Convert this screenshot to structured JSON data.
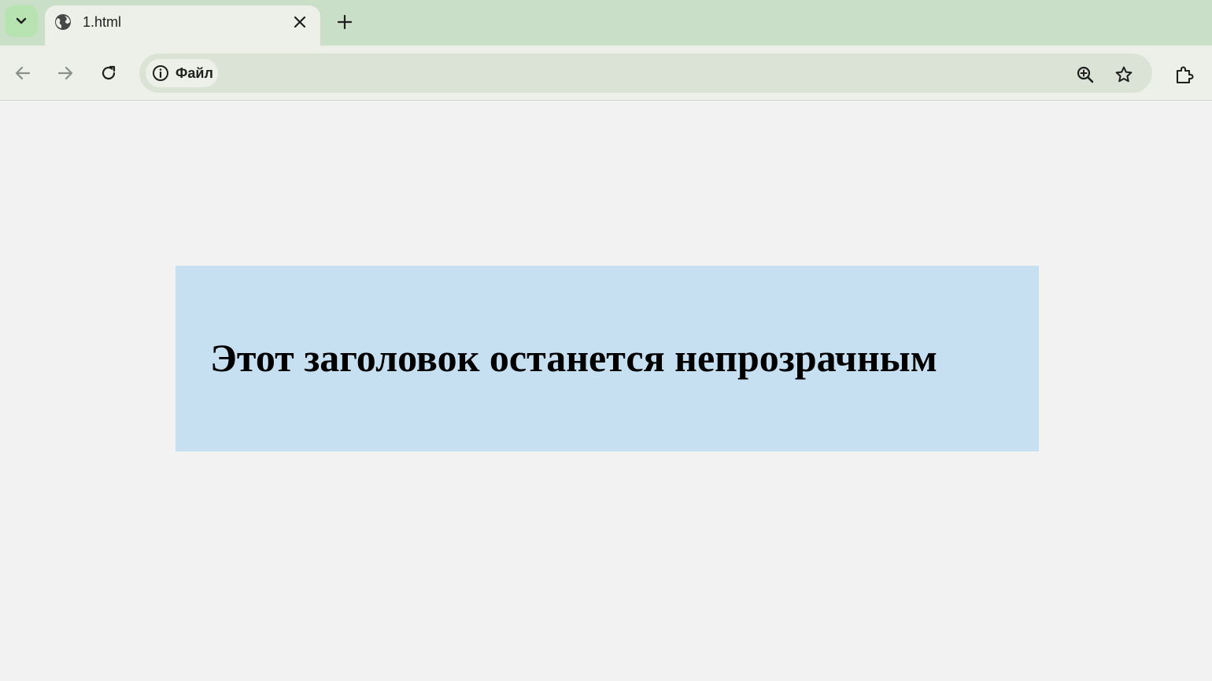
{
  "browser": {
    "tab": {
      "title": "1.html"
    },
    "address": {
      "chip_label": "Файл"
    },
    "icons": {
      "tab_search": "chevron-down-icon",
      "favicon": "globe-icon",
      "close": "close-icon",
      "new_tab": "plus-icon",
      "back": "arrow-left-icon",
      "forward": "arrow-right-icon",
      "reload": "reload-icon",
      "site_info": "info-icon",
      "zoom": "zoom-in-icon",
      "bookmark": "star-icon",
      "extensions": "puzzle-icon"
    },
    "colors": {
      "tabstrip": "#cadfc7",
      "toolbar": "#ecf0e8",
      "omnibox": "#dbe3d6"
    }
  },
  "page": {
    "heading": "Этот заголовок останется непрозрачным",
    "box_color": "#c6e0f2",
    "background": "#f2f2f2"
  }
}
